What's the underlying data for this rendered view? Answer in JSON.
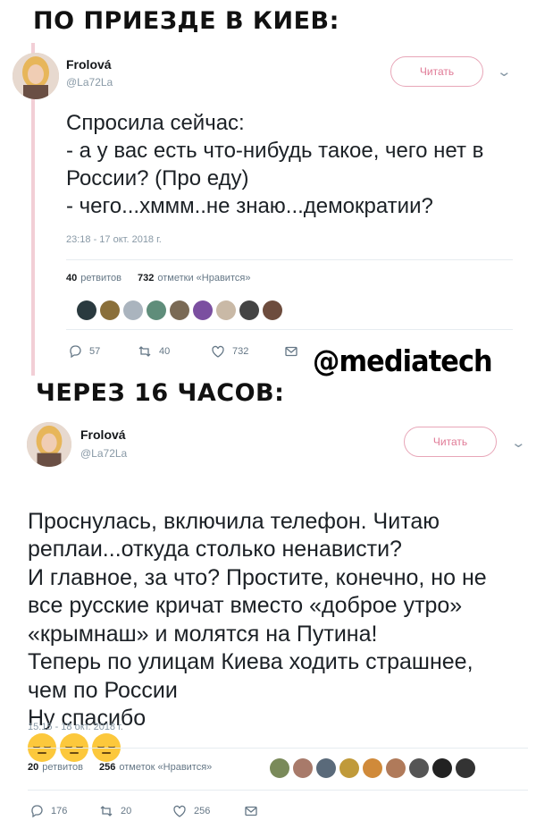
{
  "captions": {
    "top": "ПО ПРИЕЗДЕ В КИЕВ:",
    "middle": "ЧЕРЕЗ 16 ЧАСОВ:"
  },
  "watermark": "@mediatech",
  "colors": {
    "follow_accent": "#e07a96",
    "thread_line": "#f2cfd6",
    "muted_text": "#8899a6"
  },
  "tweets": [
    {
      "author": {
        "name": "Frolová",
        "handle": "@La72La"
      },
      "follow_label": "Читать",
      "text": "Спросила сейчас:\n- а у вас есть что-нибудь такое, чего нет в России? (Про еду)\n- чего...хммм..не знаю...демократии?",
      "timestamp": "23:18 - 17 окт. 2018 г.",
      "retweets_count": "40",
      "retweets_label": "ретвитов",
      "likes_count": "732",
      "likes_label": "отметки «Нравится»",
      "likers": [
        "#2a3a3f",
        "#8a6f3a",
        "#aab4be",
        "#5f8d7a",
        "#7a6a55",
        "#7b4fa0",
        "#c9b9a6",
        "#444444",
        "#6d4c3d"
      ],
      "actions": {
        "reply": "57",
        "retweet": "40",
        "like": "732"
      }
    },
    {
      "author": {
        "name": "Frolová",
        "handle": "@La72La"
      },
      "follow_label": "Читать",
      "text": "Проснулась, включила телефон. Читаю реплаи...откуда столько ненависти?\nИ главное, за что? Простите, конечно, но не все русские кричат вместо «доброе утро» «крымнаш» и молятся на Путина!\nТеперь по улицам Киева ходить страшнее, чем по России\nНу спасибо",
      "emoji": "pensive-face",
      "emoji_count": 3,
      "timestamp": "15:15 - 18 окт. 2018 г.",
      "retweets_count": "20",
      "retweets_label": "ретвитов",
      "likes_count": "256",
      "likes_label": "отметок «Нравится»",
      "likers": [
        "#7a8a5a",
        "#a87a6a",
        "#5a6a7a",
        "#c09a3a",
        "#d08a3a",
        "#b07a5a",
        "#555555",
        "#222222",
        "#333333"
      ],
      "actions": {
        "reply": "176",
        "retweet": "20",
        "like": "256"
      }
    }
  ]
}
